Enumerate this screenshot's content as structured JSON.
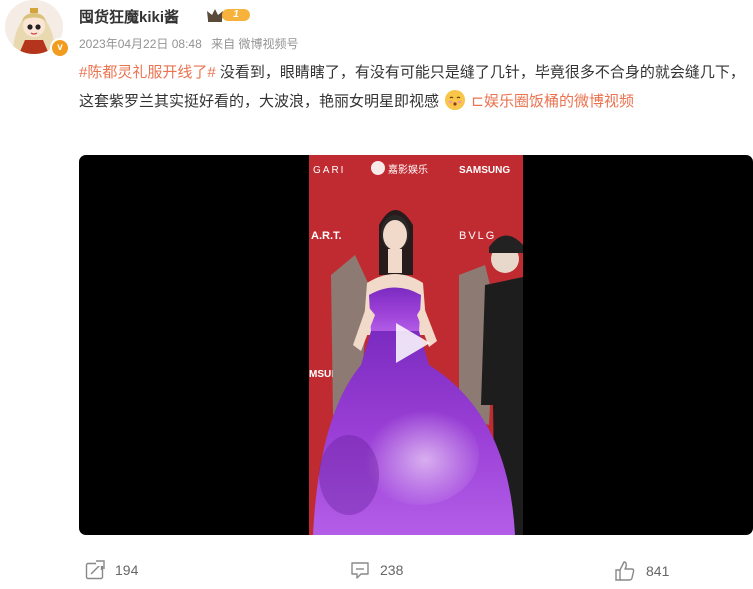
{
  "post": {
    "username": "囤货狂魔kiki酱",
    "rank_level": "1",
    "verified_mark": "v",
    "date": "2023年04月22日 08:48",
    "source": "来自 微博视频号",
    "hashtag": "#陈都灵礼服开线了#",
    "body_text": "没看到，眼睛瞎了，有没有可能只是缝了几针，毕竟很多不合身的就会缝几下，这套紫罗兰其实挺好看的，大波浪，艳丽女明星即视感",
    "video_link_text": "娱乐圈饭桶的微博视频",
    "video_link_prefix": "⊏"
  },
  "video": {
    "backdrop_texts": [
      "GARI",
      "嘉影娱乐",
      "SAMSUNG",
      "A.R.T.",
      "BVLG",
      "MSUNG"
    ],
    "play_icon": "play-icon"
  },
  "actions": {
    "repost_count": "194",
    "comment_count": "238",
    "like_count": "841"
  },
  "colors": {
    "link": "#eb7350",
    "backdrop_red": "#c42a2f",
    "gown_purple": "#8e32c9"
  }
}
